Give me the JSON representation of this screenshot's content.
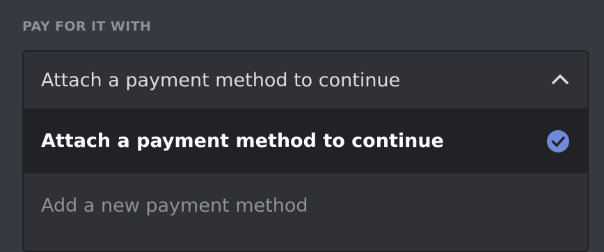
{
  "section": {
    "label": "PAY FOR IT WITH"
  },
  "dropdown": {
    "selected_value": "Attach a payment method to continue",
    "state": "expanded",
    "toggle_icon": "chevron-up-icon",
    "options": [
      {
        "label": "Attach a payment method to continue",
        "selected": true,
        "icon": "checkmark-circle-icon"
      },
      {
        "label": "Add a new payment method",
        "selected": false
      }
    ]
  },
  "colors": {
    "background": "#36393f",
    "dropdown_bg": "#2f3136",
    "selected_bg": "#202225",
    "accent": "#7289da",
    "muted_text": "#8e9297"
  }
}
